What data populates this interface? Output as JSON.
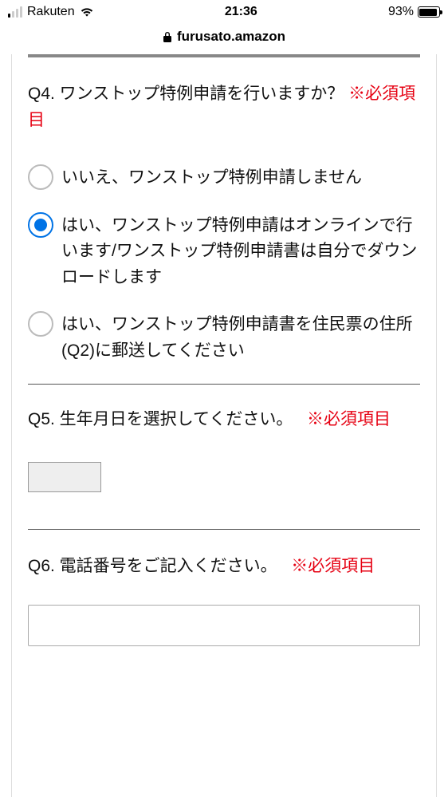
{
  "statusBar": {
    "carrier": "Rakuten",
    "time": "21:36",
    "batteryPercent": "93%",
    "batteryFill": 93
  },
  "urlBar": {
    "host": "furusato.amazon"
  },
  "q4": {
    "label": "Q4. ワンストップ特例申請を行いますか？",
    "requiredMark": "※必須項目",
    "options": {
      "o1": "いいえ、ワンストップ特例申請しません",
      "o2": "はい、ワンストップ特例申請はオンラインで行います/ワンストップ特例申請書は自分でダウンロードします",
      "o3": "はい、ワンストップ特例申請書を住民票の住所(Q2)に郵送してください"
    },
    "selected": "o2"
  },
  "q5": {
    "label": "Q5. 生年月日を選択してください。",
    "requiredMark": "※必須項目",
    "dateValue": ""
  },
  "q6": {
    "label": "Q6. 電話番号をご記入ください。",
    "requiredMark": "※必須項目",
    "value": ""
  }
}
